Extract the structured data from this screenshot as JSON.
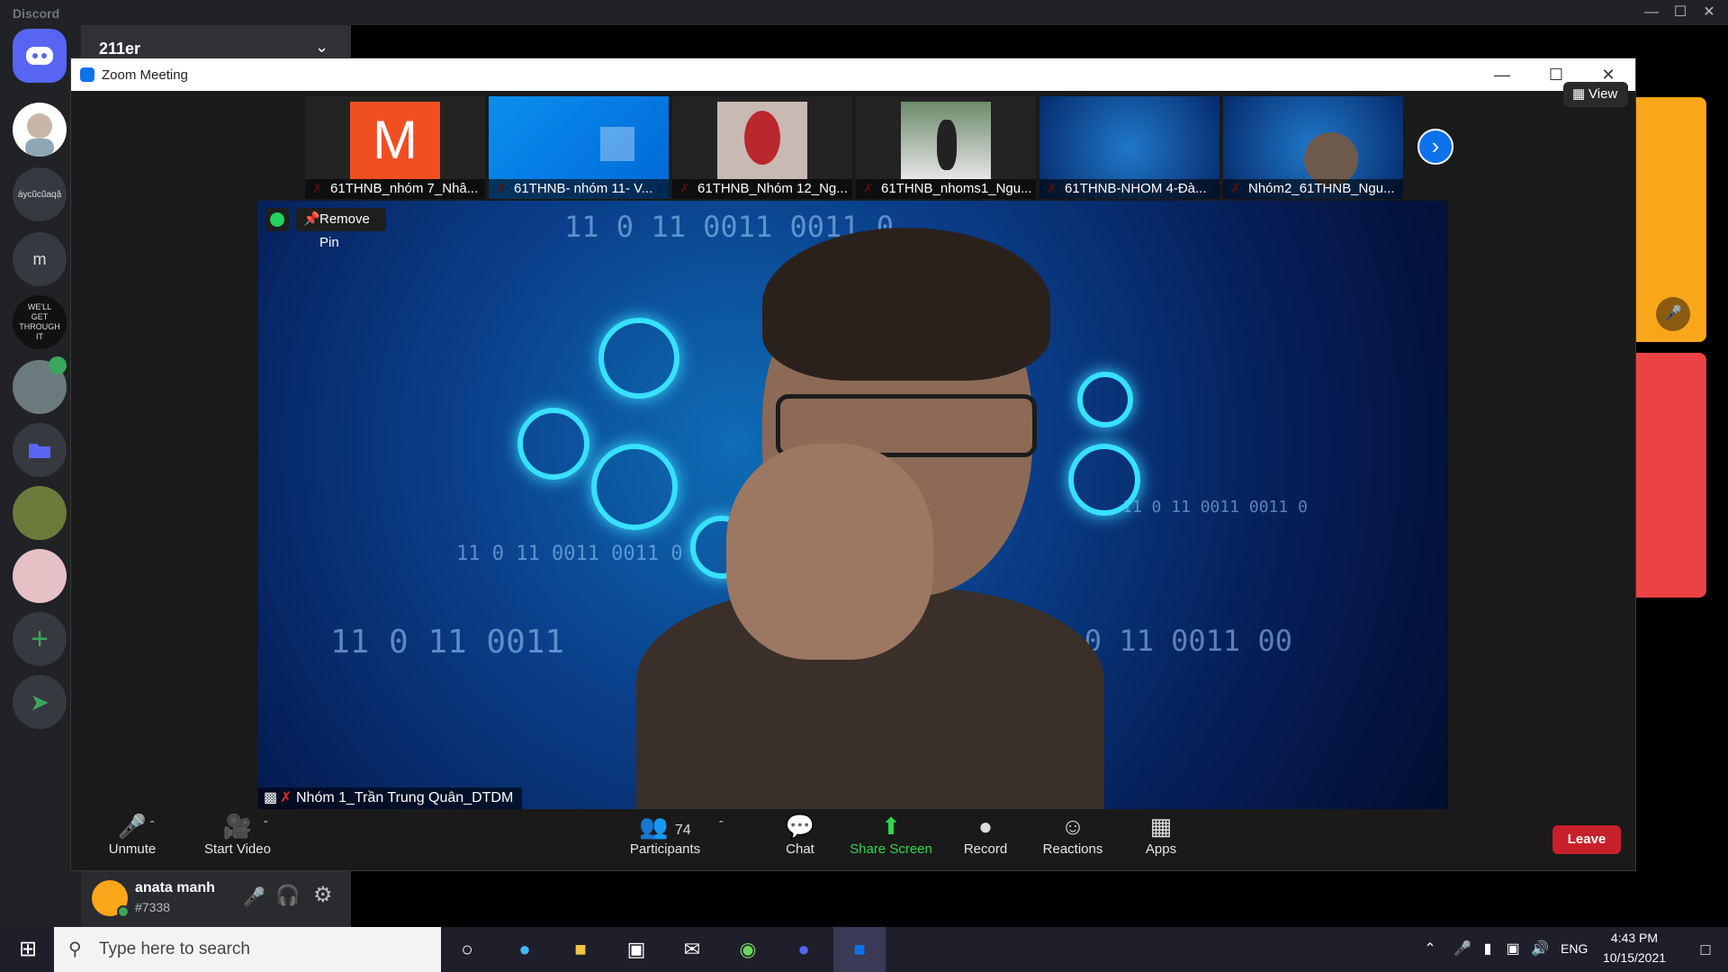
{
  "discord": {
    "app_title": "Discord",
    "server_name": "211er",
    "servers": [
      "",
      "áycũcũaqậ",
      "m",
      "WE'LL GET THROUGH IT",
      "",
      "",
      "",
      ""
    ],
    "user": {
      "name": "anata manh",
      "tag": "#7338"
    }
  },
  "zoom": {
    "window_title": "Zoom Meeting",
    "view_label": "View",
    "remove_pin_label": "Remove Pin",
    "thumbnails": [
      {
        "name": "61THNB_nhóm 7_Nhâ...",
        "initial": "M"
      },
      {
        "name": "61THNB- nhóm 11- V..."
      },
      {
        "name": "61THNB_Nhóm 12_Ng..."
      },
      {
        "name": "61THNB_nhoms1_Ngu..."
      },
      {
        "name": "61THNB-NHOM 4-Đà..."
      },
      {
        "name": "Nhóm2_61THNB_Ngu..."
      }
    ],
    "main_speaker": "Nhóm 1_Trần Trung Quân_DTDM",
    "toolbar": {
      "unmute": "Unmute",
      "start_video": "Start Video",
      "participants": "Participants",
      "participant_count": "74",
      "chat": "Chat",
      "share_screen": "Share Screen",
      "record": "Record",
      "reactions": "Reactions",
      "apps": "Apps",
      "leave": "Leave"
    }
  },
  "taskbar": {
    "search_placeholder": "Type here to search",
    "language": "ENG",
    "time": "4:43 PM",
    "date": "10/15/2021"
  },
  "colors": {
    "discord_bg": "#202225",
    "zoom_green": "#2bd94b",
    "leave_red": "#c8202a",
    "accent_blue": "#0e72ed"
  }
}
